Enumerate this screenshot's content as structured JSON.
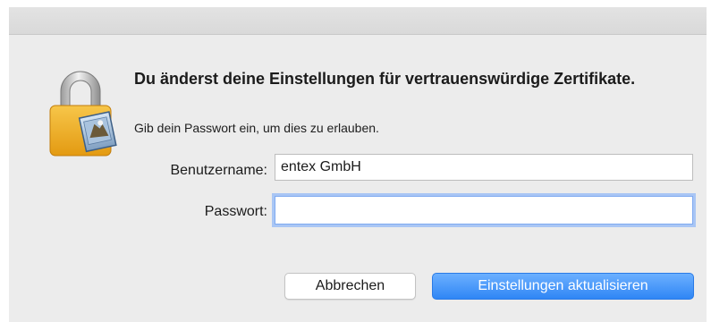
{
  "dialog": {
    "heading": "Du änderst deine Einstellungen für vertrauenswürdige Zertifikate.",
    "subtext": "Gib dein Passwort ein, um dies zu erlauben.",
    "fields": {
      "username_label": "Benutzername:",
      "username_value": "entex GmbH",
      "password_label": "Passwort:",
      "password_value": ""
    },
    "buttons": {
      "cancel_label": "Abbrechen",
      "confirm_label": "Einstellungen aktualisieren"
    },
    "icon": "lock-with-certificate-icon"
  },
  "colors": {
    "background": "#ececec",
    "primary_button": "#2f86f5",
    "focus_ring": "#a9c6f5",
    "lock_body": "#f1b12e"
  }
}
